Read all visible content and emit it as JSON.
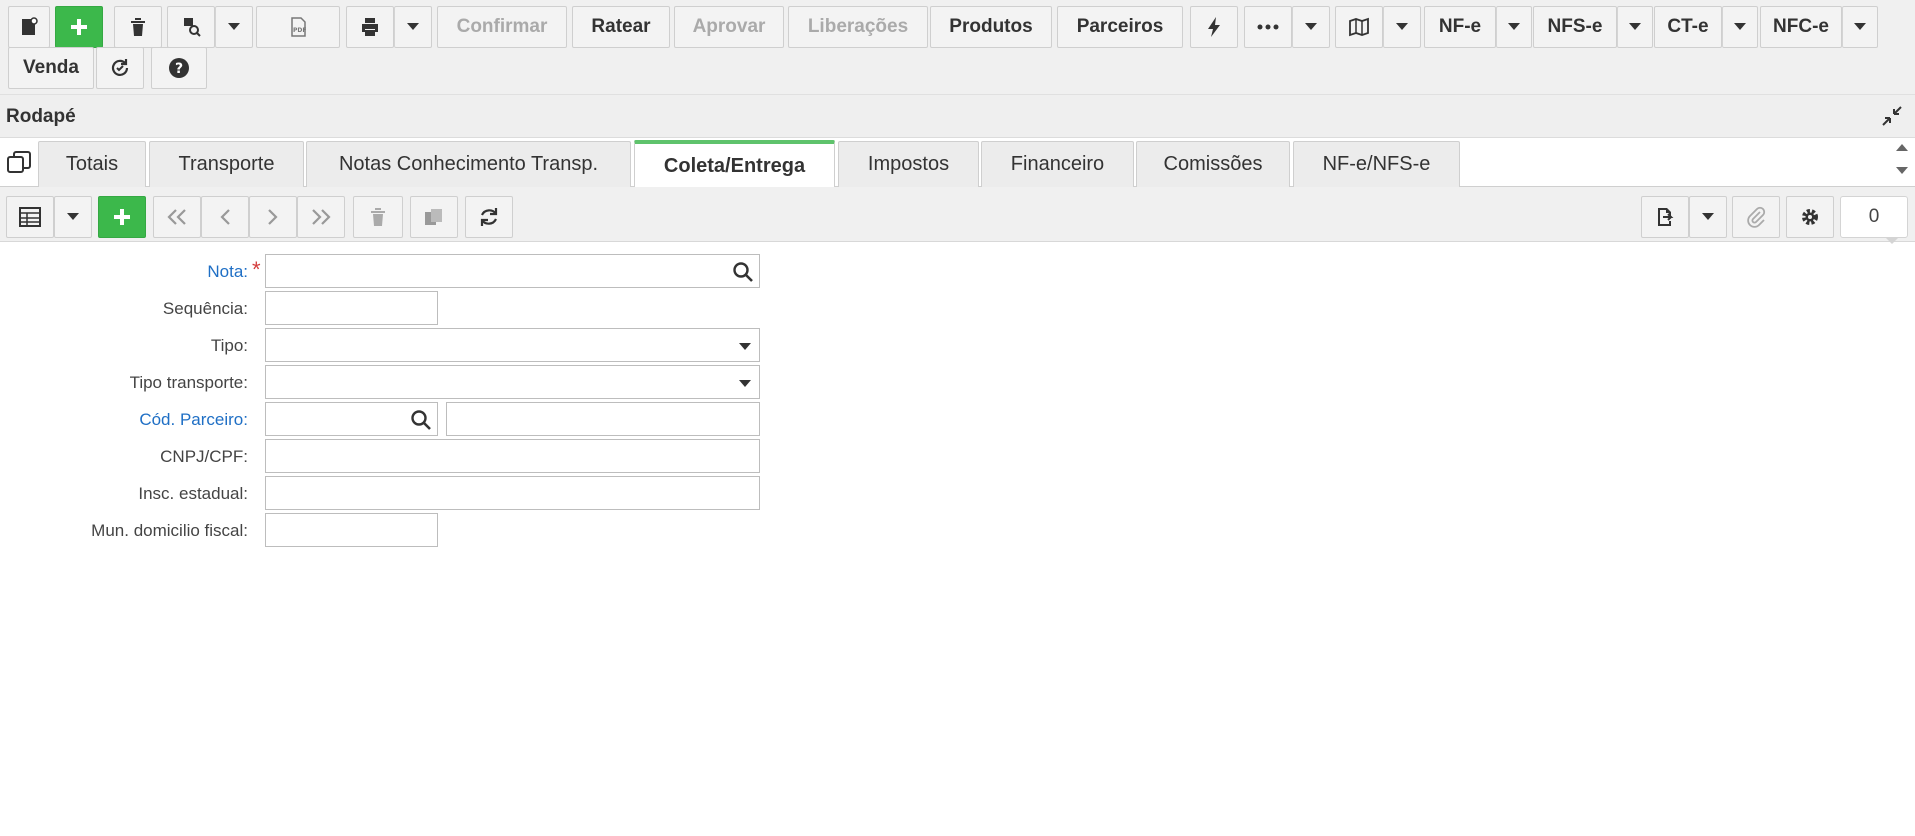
{
  "toolbar": {
    "row1": {
      "confirmar": "Confirmar",
      "ratear": "Ratear",
      "aprovar": "Aprovar",
      "liberacoes": "Liberações",
      "produtos": "Produtos",
      "parceiros": "Parceiros",
      "nfe": "NF-e",
      "nfse": "NFS-e",
      "cte": "CT-e",
      "nfce": "NFC-e"
    },
    "row2": {
      "venda": "Venda"
    }
  },
  "section": {
    "title": "Rodapé"
  },
  "tabs": [
    {
      "label": "Totais"
    },
    {
      "label": "Transporte"
    },
    {
      "label": "Notas Conhecimento Transp."
    },
    {
      "label": "Coleta/Entrega"
    },
    {
      "label": "Impostos"
    },
    {
      "label": "Financeiro"
    },
    {
      "label": "Comissões"
    },
    {
      "label": "NF-e/NFS-e"
    }
  ],
  "active_tab": "Coleta/Entrega",
  "grid_toolbar": {
    "record_count": "0"
  },
  "form": {
    "nota_label": "Nota:",
    "nota_required": "*",
    "sequencia_label": "Sequência:",
    "tipo_label": "Tipo:",
    "tipo_transporte_label": "Tipo transporte:",
    "cod_parceiro_label": "Cód. Parceiro:",
    "cnpj_cpf_label": "CNPJ/CPF:",
    "insc_estadual_label": "Insc. estadual:",
    "mun_domicilio_label": "Mun. domicilio fiscal:"
  },
  "colors": {
    "primary_green": "#3cb84b",
    "active_tab_accent": "#5fc36c",
    "link_blue": "#1f6fc5",
    "required_red": "#d43c3c"
  }
}
